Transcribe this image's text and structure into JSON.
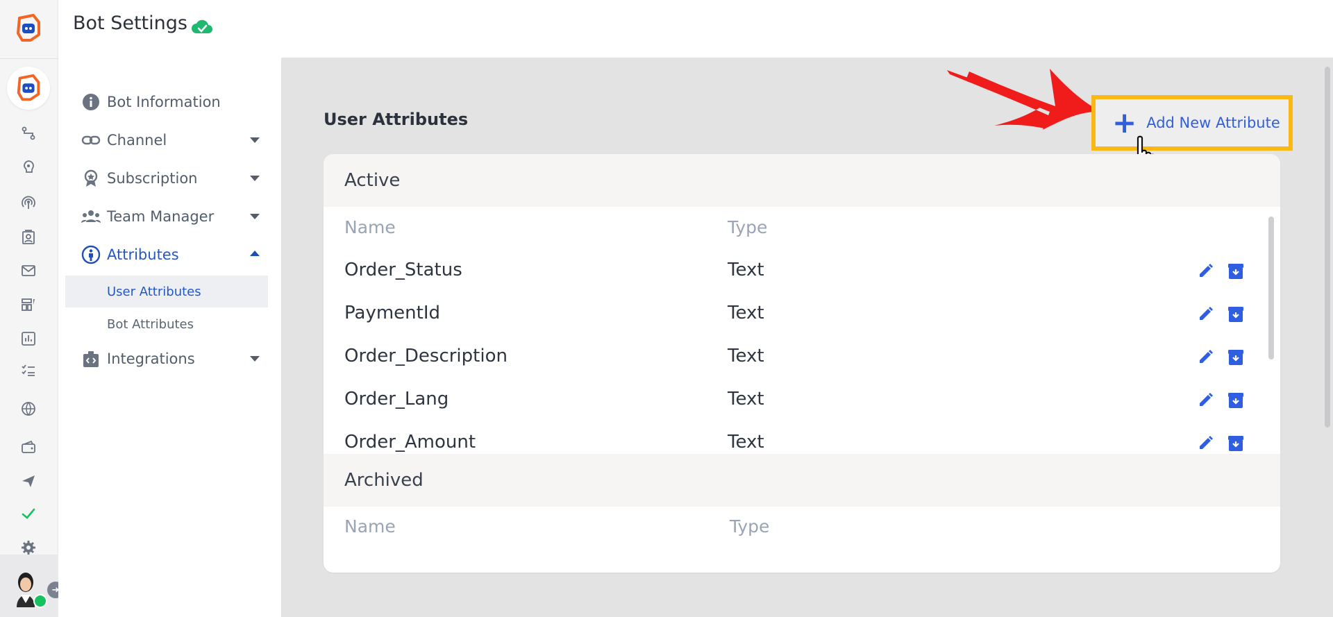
{
  "header": {
    "title": "Bot Settings",
    "status_icon": "cloud-check-icon"
  },
  "rail": {
    "icons": [
      "flow-icon",
      "brain-icon",
      "broadcast-icon",
      "contacts-icon",
      "mail-icon",
      "dashboard-icon",
      "analytics-icon",
      "tasks-icon",
      "globe-icon",
      "wallet-icon",
      "send-icon",
      "check-icon",
      "settings-icon"
    ]
  },
  "menu": {
    "items": [
      {
        "label": "Bot Information",
        "icon": "info-icon"
      },
      {
        "label": "Channel",
        "icon": "link-icon"
      },
      {
        "label": "Subscription",
        "icon": "badge-icon"
      },
      {
        "label": "Team Manager",
        "icon": "team-icon"
      },
      {
        "label": "Attributes",
        "icon": "person-icon"
      },
      {
        "label": "Integrations",
        "icon": "integration-icon"
      }
    ],
    "subitems": [
      {
        "label": "User Attributes"
      },
      {
        "label": "Bot Attributes"
      }
    ]
  },
  "main": {
    "section_title": "User Attributes",
    "add_button_label": "Add New Attribute",
    "active_label": "Active",
    "archived_label": "Archived",
    "columns": {
      "name": "Name",
      "type": "Type"
    },
    "rows": [
      {
        "name": "Order_Status",
        "type": "Text"
      },
      {
        "name": "PaymentId",
        "type": "Text"
      },
      {
        "name": "Order_Description",
        "type": "Text"
      },
      {
        "name": "Order_Lang",
        "type": "Text"
      },
      {
        "name": "Order_Amount",
        "type": "Text"
      }
    ]
  },
  "colors": {
    "accent": "#2f5fe0",
    "highlight_border": "#fbb713",
    "arrow": "#f01c1c",
    "status_green": "#17c15d",
    "brand_orange": "#f26522"
  }
}
